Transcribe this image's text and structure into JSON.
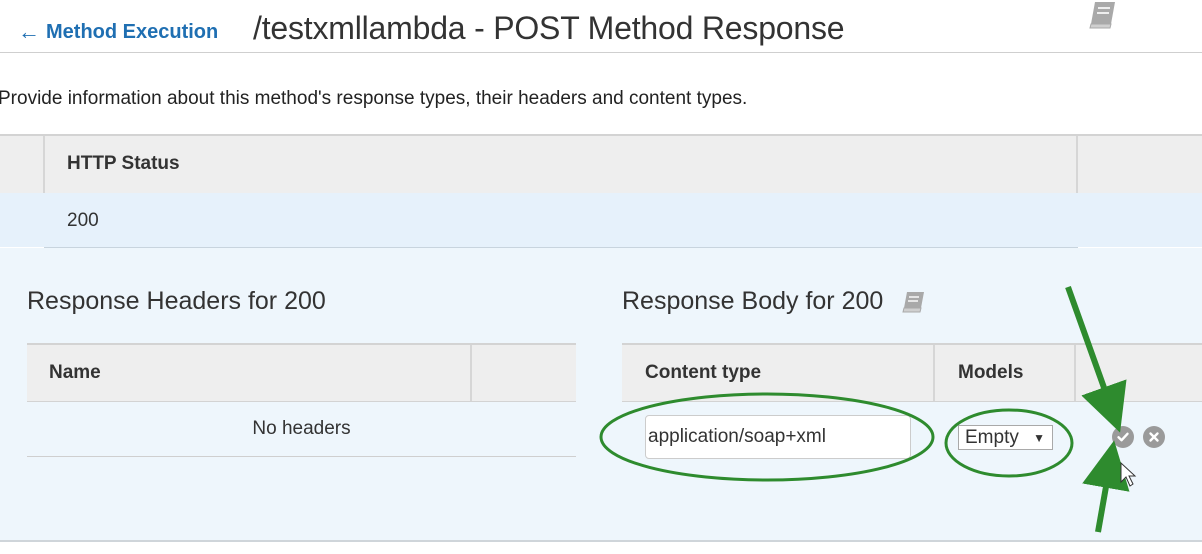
{
  "header": {
    "back_label": "Method Execution",
    "title": "/testxmllambda - POST Method Response"
  },
  "description": "Provide information about this method's response types, their headers and content types.",
  "status_table": {
    "header": "HTTP Status",
    "rows": [
      "200"
    ]
  },
  "response_headers": {
    "title": "Response Headers for 200",
    "columns": [
      "Name"
    ],
    "empty_message": "No headers"
  },
  "response_body": {
    "title": "Response Body for 200",
    "columns": [
      "Content type",
      "Models"
    ],
    "content_type_value": "application/soap+xml",
    "model_selected": "Empty"
  },
  "icons": {
    "doc": "book-icon",
    "confirm": "check-circle-icon",
    "cancel": "close-circle-icon",
    "back": "arrow-left-icon"
  },
  "colors": {
    "link": "#1f6fb2",
    "annotation": "#2e8b2e",
    "selected_row": "#e6f1fb"
  }
}
